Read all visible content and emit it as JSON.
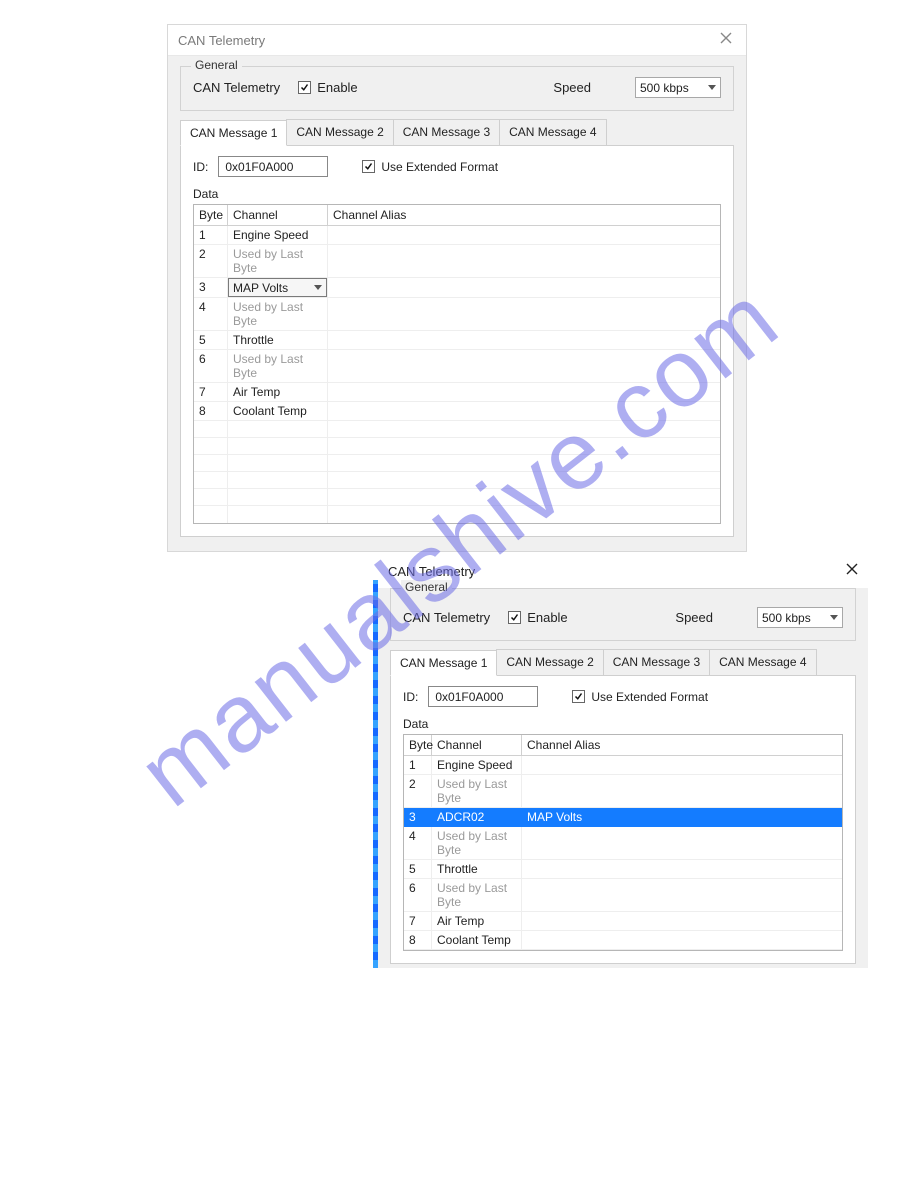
{
  "watermark": "manualshive.com",
  "dlg1": {
    "title": "CAN Telemetry",
    "general": {
      "legend": "General",
      "label": "CAN Telemetry",
      "enable_label": "Enable",
      "enable_checked": true,
      "speed_label": "Speed",
      "speed_value": "500 kbps"
    },
    "tabs": [
      "CAN Message 1",
      "CAN Message 2",
      "CAN Message 3",
      "CAN Message 4"
    ],
    "active_tab": 0,
    "id_label": "ID:",
    "id_value": "0x01F0A000",
    "ext_label": "Use Extended Format",
    "ext_checked": true,
    "data_legend": "Data",
    "columns": [
      "Byte",
      "Channel",
      "Channel Alias"
    ],
    "rows": [
      {
        "byte": "1",
        "channel": "Engine Speed",
        "alias": "",
        "grey": false,
        "editing": false
      },
      {
        "byte": "2",
        "channel": "Used by Last Byte",
        "alias": "",
        "grey": true,
        "editing": false
      },
      {
        "byte": "3",
        "channel": "MAP Volts",
        "alias": "",
        "grey": false,
        "editing": true
      },
      {
        "byte": "4",
        "channel": "Used by Last Byte",
        "alias": "",
        "grey": true,
        "editing": false
      },
      {
        "byte": "5",
        "channel": "Throttle",
        "alias": "",
        "grey": false,
        "editing": false
      },
      {
        "byte": "6",
        "channel": "Used by Last Byte",
        "alias": "",
        "grey": true,
        "editing": false
      },
      {
        "byte": "7",
        "channel": "Air Temp",
        "alias": "",
        "grey": false,
        "editing": false
      },
      {
        "byte": "8",
        "channel": "Coolant Temp",
        "alias": "",
        "grey": false,
        "editing": false
      }
    ],
    "blank_rows": 6
  },
  "dlg2": {
    "title": "CAN Telemetry",
    "general": {
      "legend": "General",
      "label": "CAN Telemetry",
      "enable_label": "Enable",
      "enable_checked": true,
      "speed_label": "Speed",
      "speed_value": "500 kbps"
    },
    "tabs": [
      "CAN Message 1",
      "CAN Message 2",
      "CAN Message 3",
      "CAN Message 4"
    ],
    "active_tab": 0,
    "id_label": "ID:",
    "id_value": "0x01F0A000",
    "ext_label": "Use Extended Format",
    "ext_checked": true,
    "data_legend": "Data",
    "columns": [
      "Byte",
      "Channel",
      "Channel Alias"
    ],
    "rows": [
      {
        "byte": "1",
        "channel": "Engine Speed",
        "alias": "",
        "grey": false,
        "sel": false
      },
      {
        "byte": "2",
        "channel": "Used by Last Byte",
        "alias": "",
        "grey": true,
        "sel": false
      },
      {
        "byte": "3",
        "channel": "ADCR02",
        "alias": "MAP Volts",
        "grey": false,
        "sel": true
      },
      {
        "byte": "4",
        "channel": "Used by Last Byte",
        "alias": "",
        "grey": true,
        "sel": false
      },
      {
        "byte": "5",
        "channel": "Throttle",
        "alias": "",
        "grey": false,
        "sel": false
      },
      {
        "byte": "6",
        "channel": "Used by Last Byte",
        "alias": "",
        "grey": true,
        "sel": false
      },
      {
        "byte": "7",
        "channel": "Air Temp",
        "alias": "",
        "grey": false,
        "sel": false
      },
      {
        "byte": "8",
        "channel": "Coolant Temp",
        "alias": "",
        "grey": false,
        "sel": false
      }
    ]
  }
}
